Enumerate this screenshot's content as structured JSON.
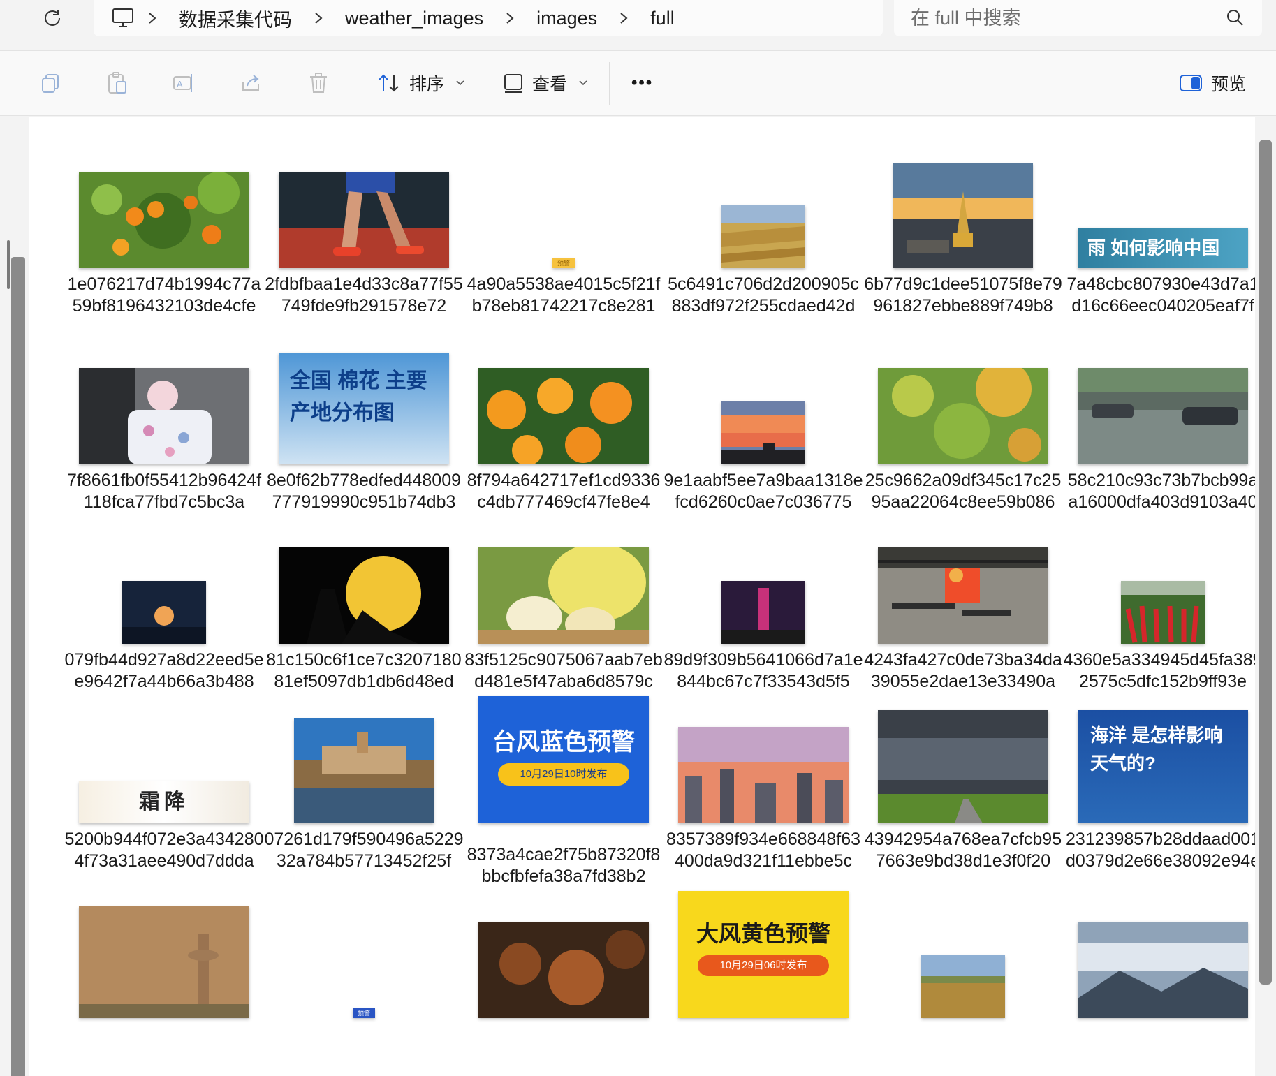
{
  "address": {
    "crumbs": [
      "数据采集代码",
      "weather_images",
      "images",
      "full"
    ]
  },
  "search": {
    "placeholder": "在 full 中搜索"
  },
  "toolbar": {
    "sort_label": "排序",
    "view_label": "查看",
    "more_label": "•••",
    "preview_label": "预览"
  },
  "files": [
    {
      "name": "1e076217d74b1994c77a59bf8196432103de4cfe"
    },
    {
      "name": "2fdbfbaa1e4d33c8a77f55749fde9fb291578e72"
    },
    {
      "name": "4a90a5538ae4015c5f21fb78eb81742217c8e281",
      "badge": "预警"
    },
    {
      "name": "5c6491c706d2d200905c883df972f255cdaed42d"
    },
    {
      "name": "6b77d9c1dee51075f8e79961827ebbe889f749b8"
    },
    {
      "name": "7a48cbc807930e43d7a1d16c66eec040205eaf7f",
      "thumb_text": "雨 如何影响中国"
    },
    {
      "name": "7f8661fb0f55412b96424f118fca77fbd7c5bc3a"
    },
    {
      "name": "8e0f62b778edfed448009777919990c951b74db3",
      "thumb_text": "全国 棉花 主要产地分布图"
    },
    {
      "name": "8f794a642717ef1cd9336c4db777469cf47fe8e4"
    },
    {
      "name": "9e1aabf5ee7a9baa1318efcd6260c0ae7c036775"
    },
    {
      "name": "25c9662a09df345c17c2595aa22064c8ee59b086"
    },
    {
      "name": "58c210c93c73b7bcb99aa16000dfa403d9103a40"
    },
    {
      "name": "079fb44d927a8d22eed5ee9642f7a44b66a3b488"
    },
    {
      "name": "81c150c6f1ce7c320718081ef5097db1db6d48ed"
    },
    {
      "name": "83f5125c9075067aab7ebd481e5f47aba6d8579c"
    },
    {
      "name": "89d9f309b5641066d7a1e844bc67c7f33543d5f5"
    },
    {
      "name": "4243fa427c0de73ba34da39055e2dae13e33490a"
    },
    {
      "name": "4360e5a334945d45fa3892575c5dfc152b9ff93e"
    },
    {
      "name": "5200b944f072e3a4342804f73a31aee490d7ddda",
      "thumb_text": "霜降"
    },
    {
      "name": "07261d179f590496a522932a784b57713452f25f"
    },
    {
      "name": "8373a4cae2f75b87320f8bbcfbfefa38a7fd38b2",
      "thumb_text": "台风蓝色预警",
      "thumb_sub": "10月29日10时发布"
    },
    {
      "name": "8357389f934e668848f63400da9d321f11ebbe5c"
    },
    {
      "name": "43942954a768ea7cfcb957663e9bd38d1e3f0f20"
    },
    {
      "name": "231239857b28ddaad001d0379d2e66e38092e94e",
      "thumb_text": "海洋 是怎样影响 天气的?"
    },
    {
      "name": ""
    },
    {
      "name": "",
      "badge": "预警"
    },
    {
      "name": ""
    },
    {
      "name": "",
      "thumb_text": "大风黄色预警",
      "thumb_sub": "10月29日06时发布"
    },
    {
      "name": ""
    },
    {
      "name": ""
    }
  ],
  "colors": {
    "accent": "#1e62d8",
    "window_bg": "#f3f3f3",
    "content_bg": "#ffffff"
  }
}
